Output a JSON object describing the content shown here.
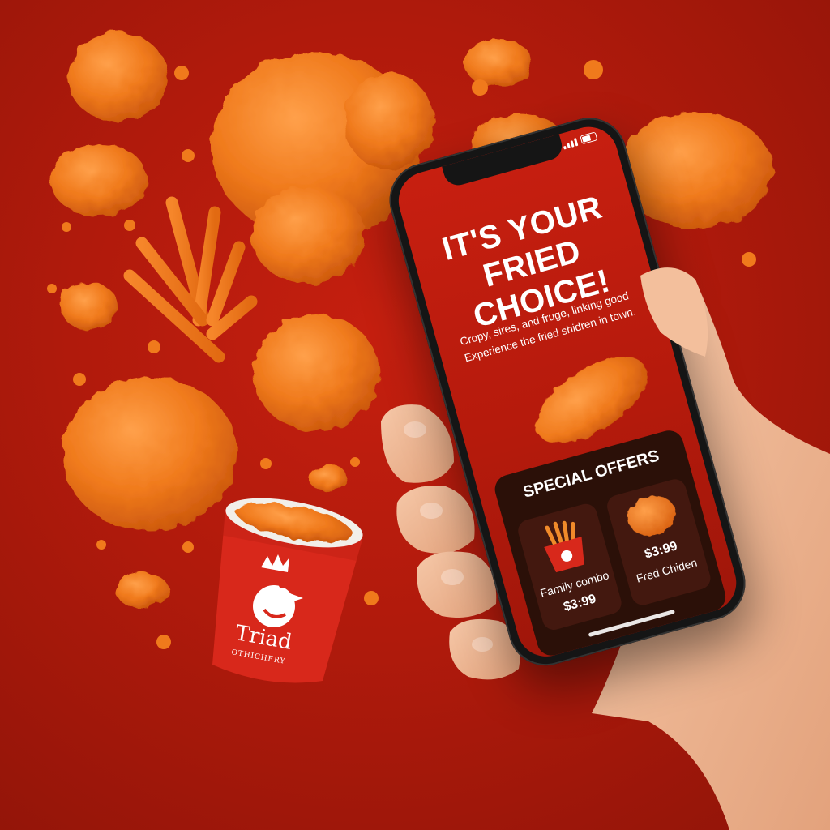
{
  "app": {
    "headline_line1": "IT'S YOUR",
    "headline_line2": "FRIED CHOICE!",
    "tagline_line1": "Cropy, sires, and fruge, linking good",
    "tagline_line2": "Experience the fried shidren in town.",
    "offers_title": "SPECIAL OFFERS",
    "offers": [
      {
        "name": "Family combo",
        "price": "$3:99",
        "icon": "fries-bucket-icon"
      },
      {
        "name": "Fred Chiden",
        "price": "$3:99",
        "icon": "fried-chicken-icon"
      }
    ]
  },
  "cup": {
    "brand": "Triad",
    "sub": "OTHICHERY",
    "logo": "rooster-logo"
  },
  "colors": {
    "background": "#b01a0c",
    "screen": "#c71f10",
    "offers_panel": "#2b1008",
    "food": "#f07a1c"
  }
}
